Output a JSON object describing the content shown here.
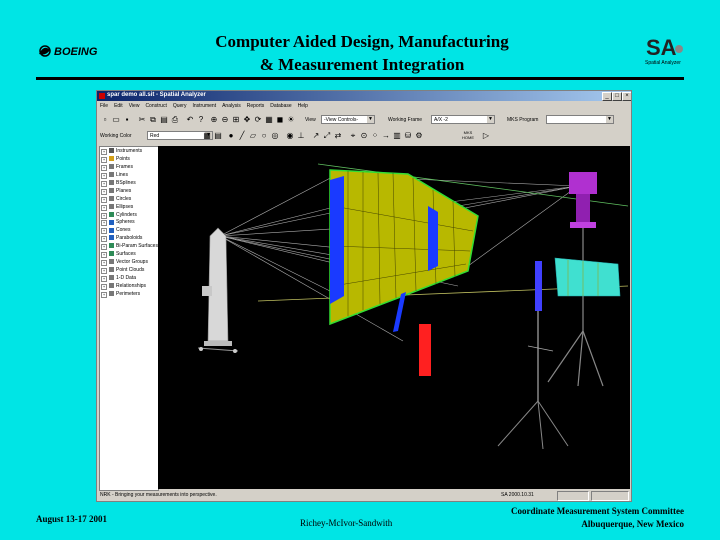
{
  "slide": {
    "title_line1": "Computer Aided Design, Manufacturing",
    "title_line2": "& Measurement Integration",
    "date": "August 13-17 2001",
    "authors": "Richey-McIvor-Sandwith",
    "committee_line1": "Coordinate Measurement System Committee",
    "committee_line2": "Albuquerque, New Mexico",
    "boeing_logo_text": "BOEING",
    "sa_logo_text": "SA",
    "sa_logo_subtext": "Spatial Analyzer"
  },
  "app": {
    "window_title": "spar demo all.sit - Spatial Analyzer",
    "menu": [
      "File",
      "Edit",
      "View",
      "Construct",
      "Query",
      "Instrument",
      "Analysis",
      "Reports",
      "Database",
      "Help"
    ],
    "toolbar": {
      "view_label": "View",
      "view_value": "-View Controls-",
      "working_frame_label": "Working Frame",
      "working_frame_value": "A/X -2",
      "mks_program_label": "MKS Program",
      "mks_program_value": "",
      "working_color_label": "Working Color",
      "working_color_value": "Red",
      "mks_button_line1": "MKS",
      "mks_button_line2": "HOME"
    },
    "tree": [
      {
        "label": "Instruments",
        "color": "#555555"
      },
      {
        "label": "Points",
        "color": "#d4a017"
      },
      {
        "label": "Frames",
        "color": "#777777"
      },
      {
        "label": "Lines",
        "color": "#777777"
      },
      {
        "label": "BSplines",
        "color": "#777777"
      },
      {
        "label": "Planes",
        "color": "#777777"
      },
      {
        "label": "Circles",
        "color": "#777777"
      },
      {
        "label": "Ellipses",
        "color": "#777777"
      },
      {
        "label": "Cylinders",
        "color": "#2e8b57"
      },
      {
        "label": "Spheres",
        "color": "#2060c0"
      },
      {
        "label": "Cones",
        "color": "#2060c0"
      },
      {
        "label": "Paraboloids",
        "color": "#2060c0"
      },
      {
        "label": "Bi-Param Surfaces",
        "color": "#2e8b57"
      },
      {
        "label": "Surfaces",
        "color": "#2e8b57"
      },
      {
        "label": "Vector Groups",
        "color": "#777777"
      },
      {
        "label": "Point Clouds",
        "color": "#777777"
      },
      {
        "label": "1-D Data",
        "color": "#777777"
      },
      {
        "label": "Relationships",
        "color": "#777777"
      },
      {
        "label": "Perimeters",
        "color": "#777777"
      }
    ],
    "status_message": "NRK - Bringing your measurements into perspective.",
    "status_version": "SA 2000.10.31"
  },
  "colors": {
    "slide_bg": "#00e5e5",
    "viewport_bg": "#000000",
    "title_bar": "#0a246a",
    "wing_yellow": "#c8c800",
    "instrument_purple": "#b030d0",
    "spar_red": "#ff1a1a",
    "spar_blue": "#2040ff",
    "panel_cyan": "#40e0d0"
  }
}
